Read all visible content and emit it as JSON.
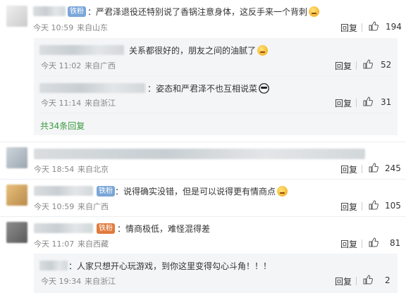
{
  "comments": [
    {
      "badge": "铁粉",
      "text": "：严君泽退役还特别说了香锅注意身体，这反手来一个背刺",
      "emoji": "emoji-shy",
      "time": "今天 10:59",
      "location": "来自山东",
      "reply_label": "回复",
      "likes": "194",
      "sub_replies": [
        {
          "text": "关系都很好的，朋友之间的油腻了",
          "emoji": "emoji-laugh",
          "time": "今天 11:02",
          "location": "来自广西",
          "reply_label": "回复",
          "likes": "52"
        },
        {
          "text": "：姿态和严君泽不也互相说菜",
          "emoji": "emoji-panda",
          "time": "今天 11:14",
          "location": "来自浙江",
          "reply_label": "回复",
          "likes": "31"
        }
      ],
      "more_link": "共34条回复"
    },
    {
      "badge": "",
      "text": "",
      "time": "今天 18:54",
      "location": "来自北京",
      "reply_label": "回复",
      "likes": "245"
    },
    {
      "badge": "铁粉",
      "text": "：说得确实没错，但是可以说得更有情商点",
      "emoji": "emoji-laugh",
      "time": "今天 10:59",
      "location": "来自广西",
      "reply_label": "回复",
      "likes": "105"
    },
    {
      "badge": "铁粉",
      "text": "：情商极低，难怪混得差",
      "time": "今天 11:07",
      "location": "来自西藏",
      "reply_label": "回复",
      "likes": "81",
      "sub_replies": [
        {
          "text": "：人家只想开心玩游戏，到你这里变得勾心斗角！！！",
          "time": "今天 19:34",
          "location": "来自浙江",
          "reply_label": "回复",
          "likes": "2"
        }
      ]
    }
  ],
  "colors": {
    "link_green": "#3a9a3f",
    "badge_blue": "#7aa6d8",
    "sub_bg": "#f4f5f7"
  }
}
